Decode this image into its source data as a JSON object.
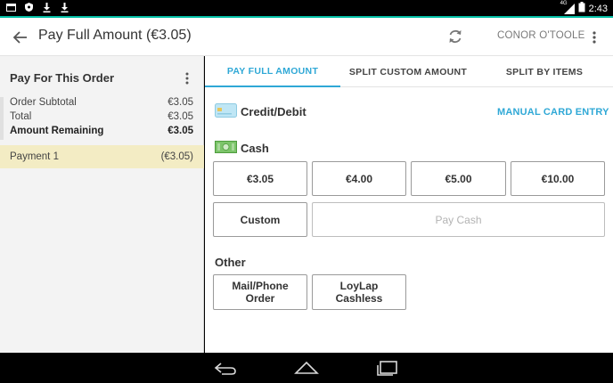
{
  "status_bar": {
    "left_icons": [
      "window-icon",
      "shield-icon",
      "download-icon",
      "download-icon"
    ],
    "network": "4G",
    "time": "2:43"
  },
  "app_bar": {
    "title": "Pay Full Amount (€3.05)",
    "user": "CONOR O'TOOLE"
  },
  "order_panel": {
    "title": "Pay For This Order",
    "rows": [
      {
        "label": "Order Subtotal",
        "value": "€3.05"
      },
      {
        "label": "Total",
        "value": "€3.05"
      },
      {
        "label": "Amount Remaining",
        "value": "€3.05"
      }
    ],
    "payment": {
      "label": "Payment 1",
      "value": "(€3.05)"
    }
  },
  "tabs": [
    {
      "label": "PAY FULL AMOUNT",
      "active": true
    },
    {
      "label": "SPLIT CUSTOM AMOUNT",
      "active": false
    },
    {
      "label": "SPLIT BY ITEMS",
      "active": false
    }
  ],
  "payment_methods": {
    "card_label": "Credit/Debit",
    "manual_entry": "MANUAL CARD ENTRY",
    "cash_label": "Cash",
    "cash_amounts": [
      "€3.05",
      "€4.00",
      "€5.00",
      "€10.00"
    ],
    "custom_label": "Custom",
    "pay_cash_label": "Pay Cash",
    "other_label": "Other",
    "other_buttons": [
      {
        "line1": "Mail/Phone",
        "line2": "Order"
      },
      {
        "line1": "LoyLap",
        "line2": "Cashless"
      }
    ]
  },
  "colors": {
    "accent": "#2fa8d6",
    "status_line": "#00bfa5",
    "payment_highlight": "#f3ecc4"
  }
}
